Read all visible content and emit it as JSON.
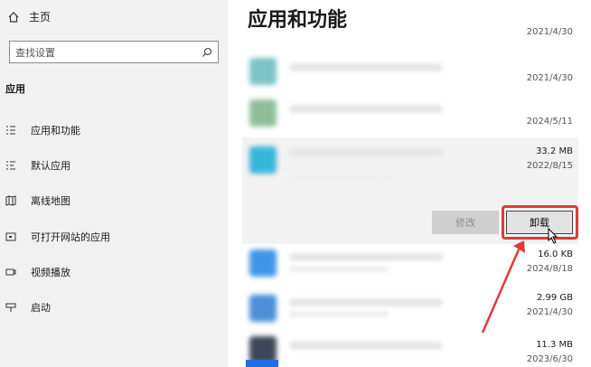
{
  "sidebar": {
    "home_label": "主页",
    "search_placeholder": "查找设置",
    "section_label": "应用",
    "items": [
      {
        "label": "应用和功能",
        "icon": "apps-features-icon"
      },
      {
        "label": "默认应用",
        "icon": "default-apps-icon"
      },
      {
        "label": "离线地图",
        "icon": "offline-maps-icon"
      },
      {
        "label": "可打开网站的应用",
        "icon": "apps-for-websites-icon"
      },
      {
        "label": "视频播放",
        "icon": "video-playback-icon"
      },
      {
        "label": "启动",
        "icon": "startup-icon"
      }
    ]
  },
  "main": {
    "title": "应用和功能",
    "apps": [
      {
        "size": "",
        "date": "2021/4/30"
      },
      {
        "size": "",
        "date": "2021/4/30"
      },
      {
        "size": "",
        "date": "2024/5/11"
      },
      {
        "size": "33.2 MB",
        "date": "2022/8/15"
      },
      {
        "size": "16.0 KB",
        "date": "2024/8/18"
      },
      {
        "size": "2.99 GB",
        "date": "2021/4/30"
      },
      {
        "size": "11.3 MB",
        "date": "2023/6/30"
      }
    ],
    "modify_label": "修改",
    "uninstall_label": "卸载"
  },
  "colors": {
    "highlight": "#e03a3a",
    "sidebar_bg": "#f1f1f1"
  }
}
